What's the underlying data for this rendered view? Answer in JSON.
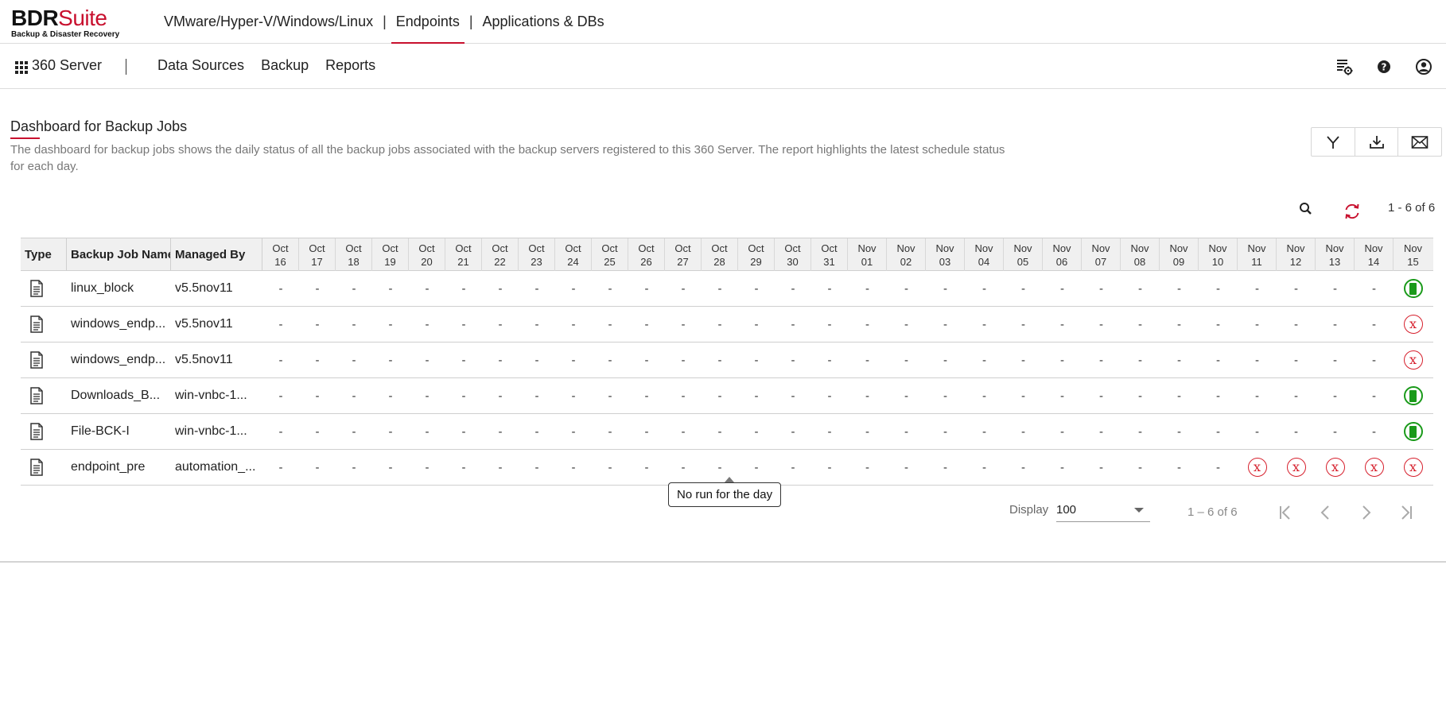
{
  "logo": {
    "main": "BDR",
    "accent": "Suite",
    "tagline": "Backup & Disaster Recovery"
  },
  "top_nav": {
    "items": [
      {
        "label": "VMware/Hyper-V/Windows/Linux",
        "active": false
      },
      {
        "label": "Endpoints",
        "active": true
      },
      {
        "label": "Applications & DBs",
        "active": false
      }
    ],
    "separator": "|"
  },
  "sub_nav": {
    "server_name": "360 Server",
    "items": [
      "Data Sources",
      "Backup",
      "Reports"
    ],
    "right_icons": [
      "settings-report-icon",
      "help-icon",
      "user-account-icon"
    ]
  },
  "page": {
    "title": "Dashboard for Backup Jobs",
    "description": "The dashboard for backup jobs shows the daily status of all the backup jobs associated with the backup servers registered to this 360 Server. The report highlights the latest schedule status for each day.",
    "actions": [
      "filter-icon",
      "download-icon",
      "email-icon"
    ],
    "record_count": "1 - 6 of 6"
  },
  "table": {
    "headers": {
      "type": "Type",
      "name": "Backup Job Name",
      "managed_by": "Managed By"
    },
    "dates": [
      [
        "Oct",
        "16"
      ],
      [
        "Oct",
        "17"
      ],
      [
        "Oct",
        "18"
      ],
      [
        "Oct",
        "19"
      ],
      [
        "Oct",
        "20"
      ],
      [
        "Oct",
        "21"
      ],
      [
        "Oct",
        "22"
      ],
      [
        "Oct",
        "23"
      ],
      [
        "Oct",
        "24"
      ],
      [
        "Oct",
        "25"
      ],
      [
        "Oct",
        "26"
      ],
      [
        "Oct",
        "27"
      ],
      [
        "Oct",
        "28"
      ],
      [
        "Oct",
        "29"
      ],
      [
        "Oct",
        "30"
      ],
      [
        "Oct",
        "31"
      ],
      [
        "Nov",
        "01"
      ],
      [
        "Nov",
        "02"
      ],
      [
        "Nov",
        "03"
      ],
      [
        "Nov",
        "04"
      ],
      [
        "Nov",
        "05"
      ],
      [
        "Nov",
        "06"
      ],
      [
        "Nov",
        "07"
      ],
      [
        "Nov",
        "08"
      ],
      [
        "Nov",
        "09"
      ],
      [
        "Nov",
        "10"
      ],
      [
        "Nov",
        "11"
      ],
      [
        "Nov",
        "12"
      ],
      [
        "Nov",
        "13"
      ],
      [
        "Nov",
        "14"
      ],
      [
        "Nov",
        "15"
      ]
    ],
    "rows": [
      {
        "name": "linux_block",
        "managed_by": "v5.5nov11",
        "statuses": {
          "30": "success"
        }
      },
      {
        "name": "windows_endp...",
        "managed_by": "v5.5nov11",
        "statuses": {
          "30": "failed"
        }
      },
      {
        "name": "windows_endp...",
        "managed_by": "v5.5nov11",
        "statuses": {
          "30": "failed"
        }
      },
      {
        "name": "Downloads_B...",
        "managed_by": "win-vnbc-1...",
        "statuses": {
          "30": "success"
        }
      },
      {
        "name": "File-BCK-I",
        "managed_by": "win-vnbc-1...",
        "statuses": {
          "30": "success"
        }
      },
      {
        "name": "endpoint_pre",
        "managed_by": "automation_...",
        "statuses": {
          "26": "failed",
          "27": "failed",
          "28": "failed",
          "29": "failed",
          "30": "failed"
        }
      }
    ],
    "empty_mark": "-",
    "failed_mark": "x"
  },
  "tooltip": {
    "text": "No run for the day"
  },
  "pager": {
    "display_label": "Display",
    "page_size": "100",
    "count": "1 – 6 of 6",
    "buttons": [
      "first-page-icon",
      "previous-page-icon",
      "next-page-icon",
      "last-page-icon"
    ]
  },
  "colors": {
    "accent": "#c8102e",
    "success": "#1a9a1a",
    "failed": "#d61f2c"
  }
}
